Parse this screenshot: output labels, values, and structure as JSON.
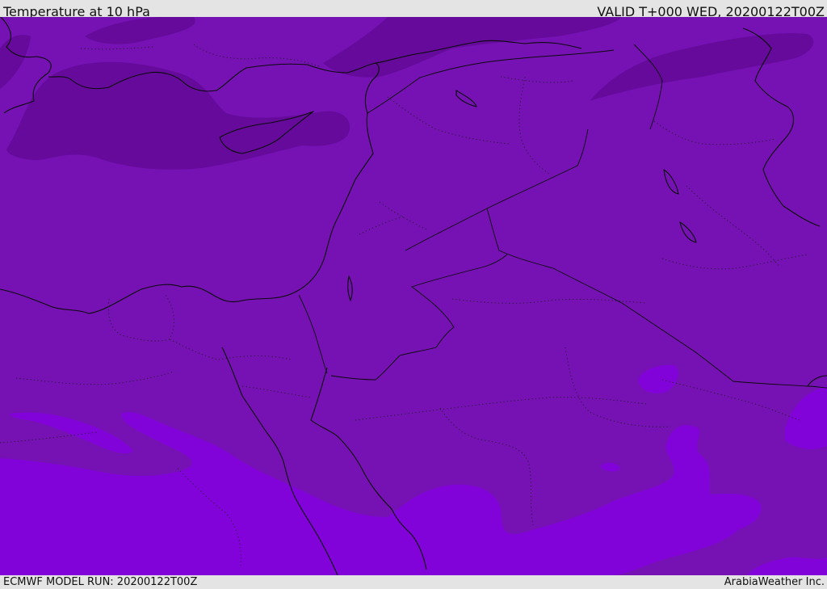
{
  "header": {
    "title": "Temperature at 10 hPa",
    "valid": "VALID T+000 WED, 20200122T00Z"
  },
  "footer": {
    "model_run": "ECMWF MODEL RUN: 20200122T00Z",
    "credit": "ArabiaWeather Inc."
  },
  "map": {
    "colors": {
      "base": "#7612b4",
      "cold_band": "#650a9b",
      "warm_band": "#8203da",
      "coast": "#0a0a0a"
    }
  }
}
